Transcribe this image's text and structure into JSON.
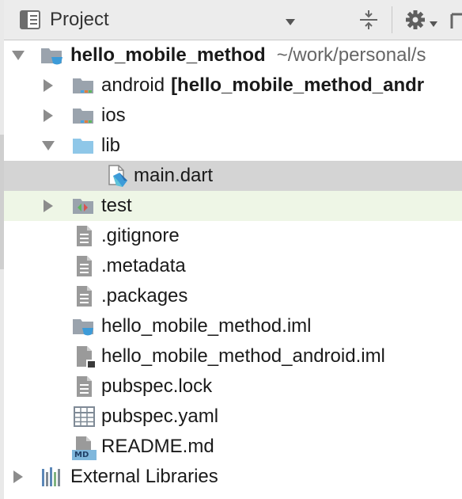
{
  "toolbar": {
    "title": "Project",
    "view_icon": "project-view-icon",
    "collapse_icon": "collapse-all-icon",
    "gear_icon": "gear-icon"
  },
  "tree": {
    "root": {
      "label": "hello_mobile_method",
      "path": "~/work/personal/s",
      "icon": "flutter-module-folder-icon"
    },
    "android": {
      "label": "android",
      "module": "[hello_mobile_method_andr",
      "icon": "module-folder-icon"
    },
    "ios": {
      "label": "ios",
      "icon": "module-folder-icon"
    },
    "lib": {
      "label": "lib",
      "icon": "source-folder-icon"
    },
    "main": {
      "label": "main.dart",
      "icon": "dart-file-icon"
    },
    "test": {
      "label": "test",
      "icon": "test-folder-icon"
    },
    "gitignore": {
      "label": ".gitignore",
      "icon": "text-file-icon"
    },
    "metadata": {
      "label": ".metadata",
      "icon": "text-file-icon"
    },
    "packages": {
      "label": ".packages",
      "icon": "text-file-icon"
    },
    "iml": {
      "label": "hello_mobile_method.iml",
      "icon": "iml-module-icon"
    },
    "android_iml": {
      "label": "hello_mobile_method_android.iml",
      "icon": "iml-file-icon"
    },
    "lock": {
      "label": "pubspec.lock",
      "icon": "text-file-icon"
    },
    "yaml": {
      "label": "pubspec.yaml",
      "icon": "yaml-file-icon"
    },
    "readme": {
      "label": "README.md",
      "icon": "markdown-file-icon",
      "badge": "MD"
    },
    "external": {
      "label": "External Libraries",
      "icon": "library-icon"
    }
  },
  "colors": {
    "selected_row": "#d4d4d4",
    "hover_row": "#eef6e6",
    "folder_gray": "#9aa3ad",
    "folder_blue": "#8fc7e8",
    "accent_blue": "#3d9bd8"
  }
}
